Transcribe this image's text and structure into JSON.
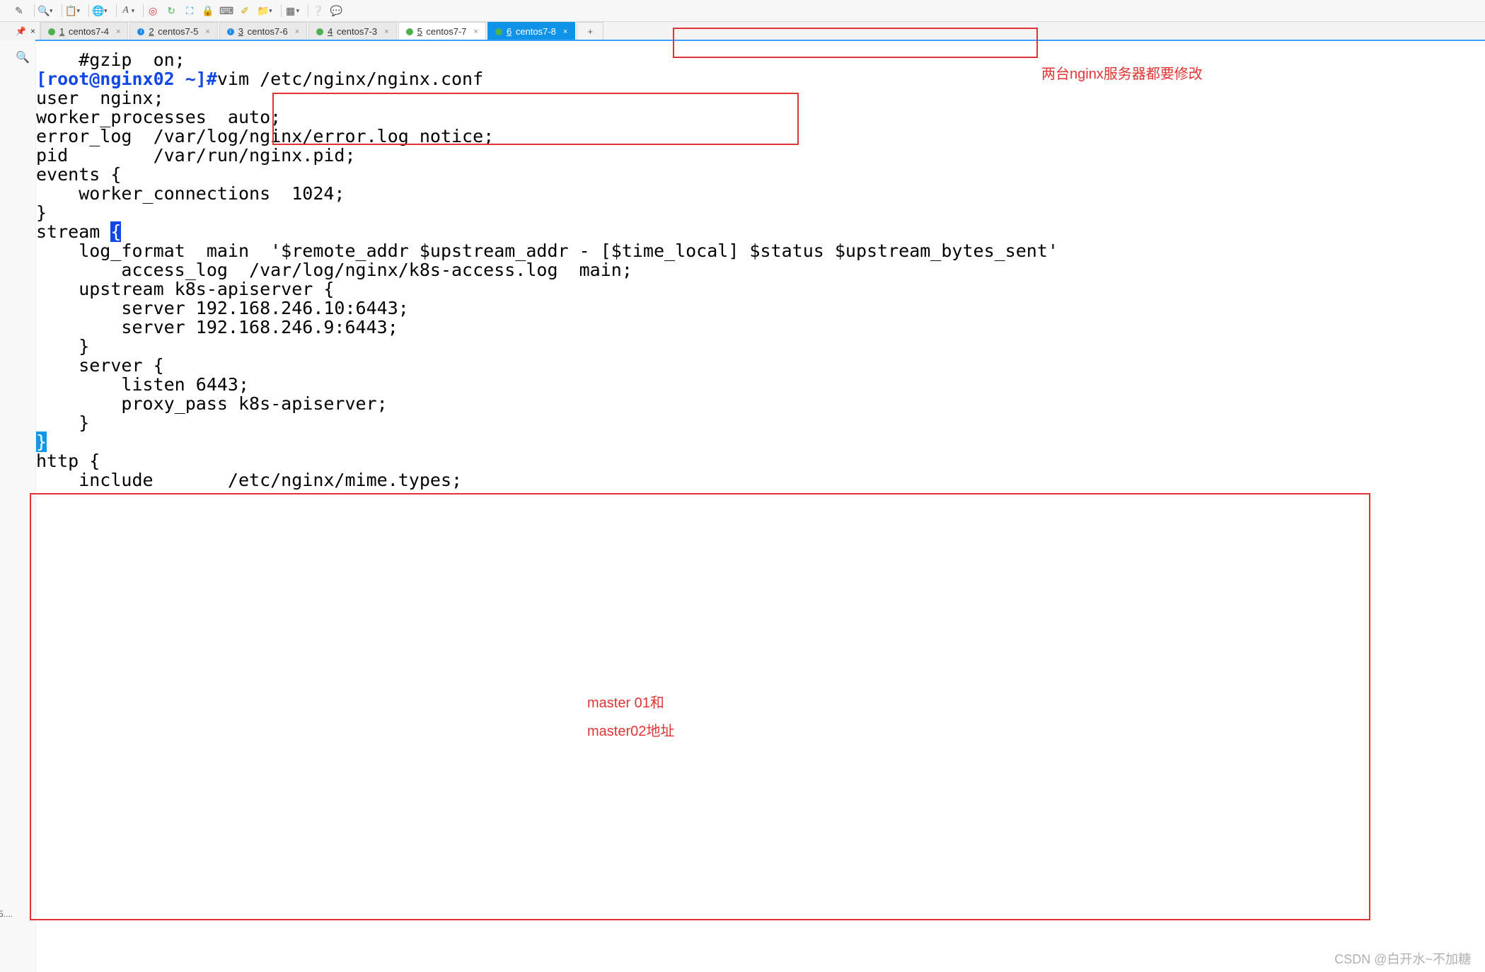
{
  "toolbar": {
    "icons": [
      {
        "name": "pencil-icon"
      },
      {
        "name": "search-icon",
        "drop": true
      },
      {
        "name": "copy-icon",
        "drop": true
      },
      {
        "name": "globe-icon",
        "drop": true
      },
      {
        "name": "font-icon",
        "label": "A",
        "drop": true
      },
      {
        "name": "target-icon",
        "red": true
      },
      {
        "name": "refresh-icon"
      },
      {
        "name": "expand-icon"
      },
      {
        "name": "lock-icon"
      },
      {
        "name": "keyboard-icon"
      },
      {
        "name": "highlighter-icon"
      },
      {
        "name": "add-folder-icon",
        "drop": true
      },
      {
        "name": "layout-icon",
        "drop": true
      },
      {
        "name": "help-icon"
      },
      {
        "name": "chat-icon"
      }
    ]
  },
  "pin": {
    "pin_label": "📌",
    "close_label": "×"
  },
  "tabs": [
    {
      "status": "green",
      "num": "1",
      "label": "centos7-4",
      "close": "×"
    },
    {
      "status": "info",
      "num": "2",
      "label": "centos7-5",
      "close": "×"
    },
    {
      "status": "info",
      "num": "3",
      "label": "centos7-6",
      "close": "×"
    },
    {
      "status": "green",
      "num": "4",
      "label": "centos7-3",
      "close": "×"
    },
    {
      "status": "green",
      "num": "5",
      "label": "centos7-7",
      "close": "×"
    },
    {
      "status": "green",
      "num": "6",
      "label": "centos7-8",
      "close": "×",
      "active": true
    }
  ],
  "plus_tab": "+",
  "gutter": {
    "mag": "🔍",
    "bottom": "5...."
  },
  "terminal": {
    "l1": "    #gzip  on;",
    "prompt": "[root@nginx02 ~]#",
    "cmd": "vim /etc/nginx/nginx.conf",
    "l_blank": "",
    "l_user": "user  nginx;",
    "l_wp": "worker_processes  auto;",
    "l_err": "error_log  /var/log/nginx/error.log notice;",
    "l_pid": "pid        /var/run/nginx.pid;",
    "l_ev": "events {",
    "l_wc": "    worker_connections  1024;",
    "l_evc": "}",
    "l_stream_pre": "stream ",
    "l_stream_brace": "{",
    "l_lf": "    log_format  main  '$remote_addr $upstream_addr - [$time_local] $status $upstream_bytes_sent'",
    "l_al": "        access_log  /var/log/nginx/k8s-access.log  main;",
    "l_up": "    upstream k8s-apiserver {",
    "l_s1": "        server 192.168.246.10:6443;",
    "l_s2": "        server 192.168.246.9:6443;",
    "l_upc": "    }",
    "l_sv": "    server {",
    "l_listen": "        listen 6443;",
    "l_pp": "        proxy_pass k8s-apiserver;",
    "l_svc": "    }",
    "l_close": "}",
    "l_http": "http {",
    "l_inc": "    include       /etc/nginx/mime.types;"
  },
  "notes": {
    "top": "两台nginx服务器都要修改",
    "mid1": "master 01和",
    "mid2": "master02地址"
  },
  "watermark": "CSDN @白开水~不加糖"
}
